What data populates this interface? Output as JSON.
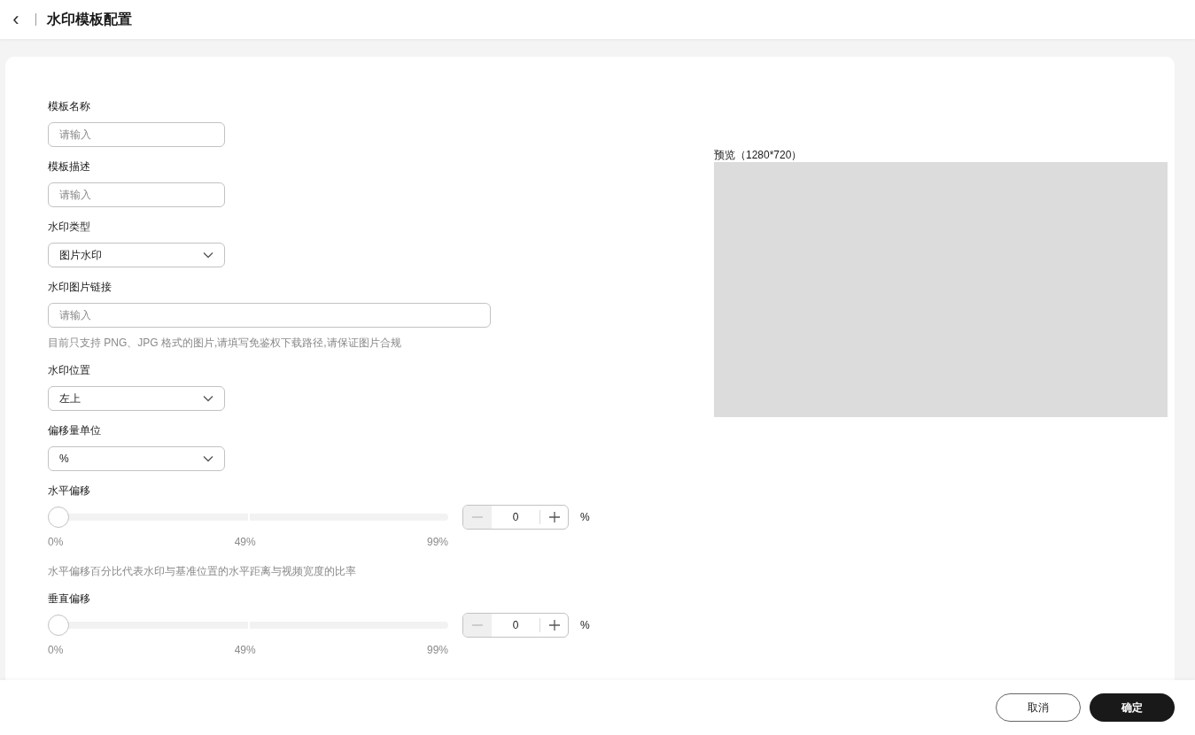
{
  "header": {
    "back_icon": "‹",
    "title": "水印模板配置"
  },
  "form": [
    {
      "kind": "text",
      "label": "模板名称",
      "placeholder": "请输入",
      "wide": false
    },
    {
      "kind": "text",
      "label": "模板描述",
      "placeholder": "请输入",
      "wide": false
    },
    {
      "kind": "select",
      "label": "水印类型",
      "value": "图片水印"
    },
    {
      "kind": "text",
      "label": "水印图片链接",
      "placeholder": "请输入",
      "wide": true,
      "hint": "目前只支持 PNG、JPG 格式的图片,请填写免鉴权下载路径,请保证图片合规"
    },
    {
      "kind": "select",
      "label": "水印位置",
      "value": "左上"
    },
    {
      "kind": "select",
      "label": "偏移量单位",
      "value": "%"
    },
    {
      "kind": "slider",
      "label": "水平偏移",
      "level": 0,
      "value": "0",
      "unit": "%",
      "decrement_disabled": true,
      "ticks": [
        "0%",
        "49%",
        "99%"
      ],
      "hint": "水平偏移百分比代表水印与基准位置的水平距离与视频宽度的比率"
    },
    {
      "kind": "slider",
      "label": "垂直偏移",
      "level": 0,
      "value": "0",
      "unit": "%",
      "decrement_disabled": true,
      "ticks": [
        "0%",
        "49%",
        "99%"
      ]
    }
  ],
  "preview": {
    "label": "预览（1280*720）"
  },
  "footer": {
    "buttons": [
      {
        "label": "取消",
        "primary": false
      },
      {
        "label": "确定",
        "primary": true
      }
    ]
  }
}
